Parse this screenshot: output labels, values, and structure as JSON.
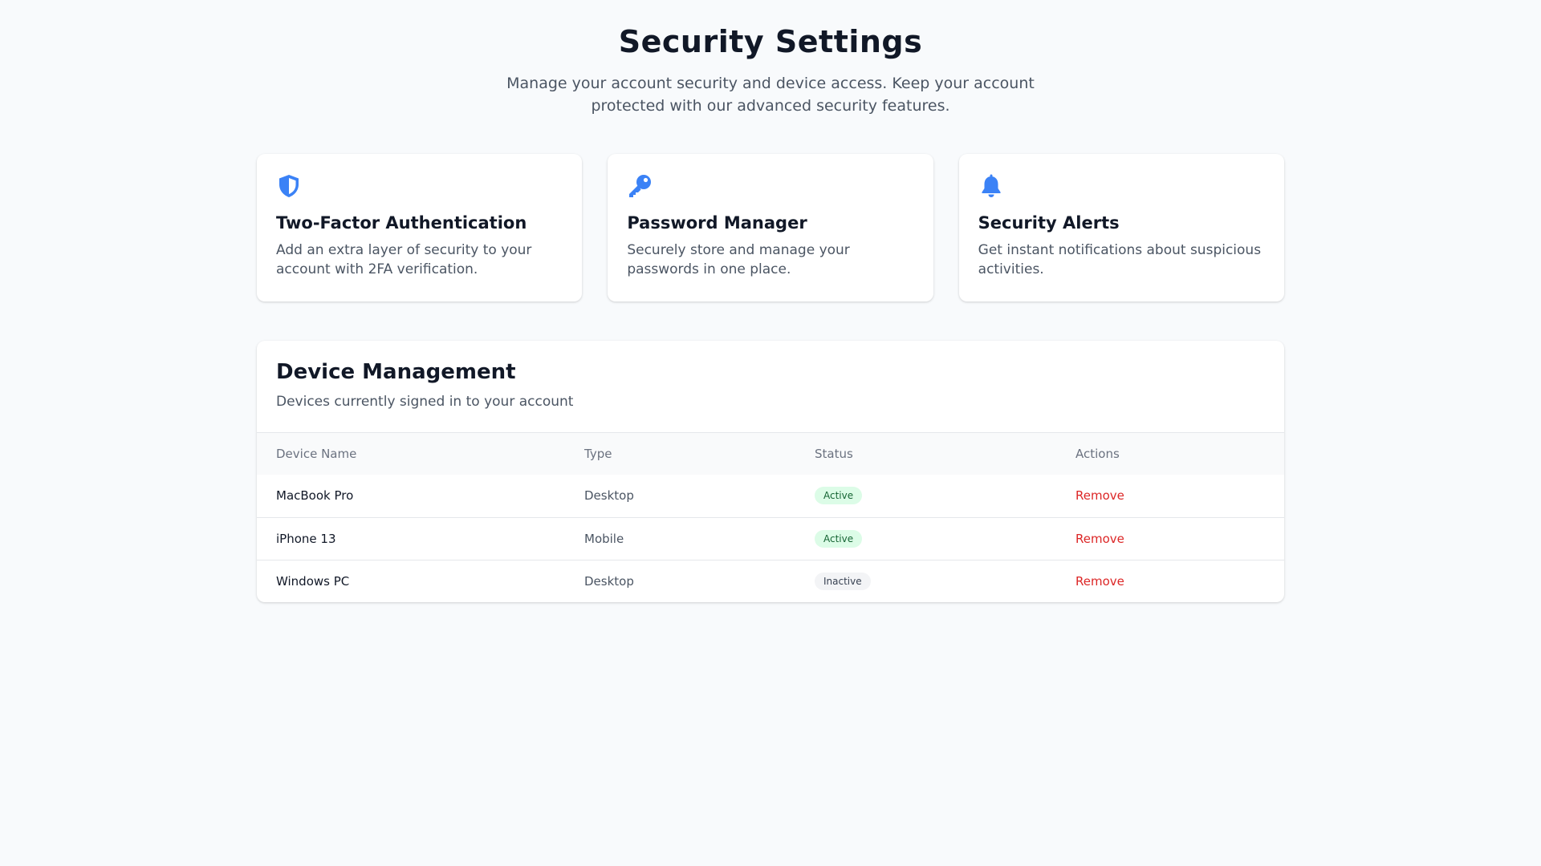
{
  "header": {
    "title": "Security Settings",
    "subtitle": "Manage your account security and device access. Keep your account protected with our advanced security features."
  },
  "cards": [
    {
      "icon": "shield-icon",
      "title": "Two-Factor Authentication",
      "description": "Add an extra layer of security to your account with 2FA verification."
    },
    {
      "icon": "key-icon",
      "title": "Password Manager",
      "description": "Securely store and manage your passwords in one place."
    },
    {
      "icon": "bell-icon",
      "title": "Security Alerts",
      "description": "Get instant notifications about suspicious activities."
    }
  ],
  "devices": {
    "title": "Device Management",
    "description": "Devices currently signed in to your account",
    "columns": [
      "Device Name",
      "Type",
      "Status",
      "Actions"
    ],
    "rows": [
      {
        "name": "MacBook Pro",
        "type": "Desktop",
        "status": "Active",
        "action": "Remove"
      },
      {
        "name": "iPhone 13",
        "type": "Mobile",
        "status": "Active",
        "action": "Remove"
      },
      {
        "name": "Windows PC",
        "type": "Desktop",
        "status": "Inactive",
        "action": "Remove"
      }
    ]
  },
  "colors": {
    "accent": "#3b82f6",
    "danger": "#dc2626",
    "active_bg": "#dcfce7",
    "active_text": "#166534",
    "inactive_bg": "#f3f4f6"
  }
}
